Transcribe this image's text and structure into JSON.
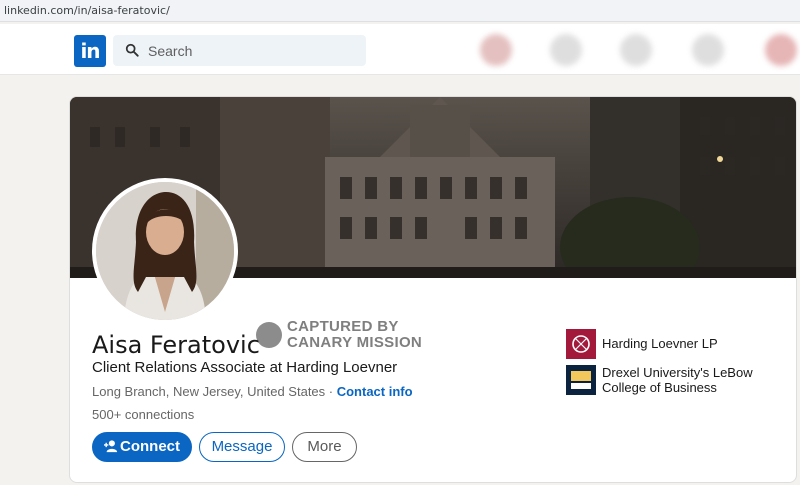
{
  "browser": {
    "url": "linkedin.com/in/aisa-feratovic/"
  },
  "nav": {
    "logo_text": "in",
    "search_placeholder": "Search",
    "icons": [
      "home-icon",
      "network-icon",
      "jobs-icon",
      "messaging-icon",
      "notifications-icon"
    ]
  },
  "profile": {
    "name": "Aisa Feratovic",
    "headline": "Client Relations Associate at Harding Loevner",
    "location": "Long Branch, New Jersey, United States",
    "location_sep": " · ",
    "contact_info": "Contact info",
    "connections": "500+ connections"
  },
  "watermark": {
    "line1": "CAPTURED BY",
    "line2": "CANARY MISSION"
  },
  "actions": {
    "connect": "Connect",
    "message": "Message",
    "more": "More"
  },
  "orgs": [
    {
      "name": "Harding Loevner LP",
      "color": "#a2193b"
    },
    {
      "name_line1": "Drexel University's LeBow",
      "name_line2": "College of Business",
      "color": "#0c2340"
    }
  ],
  "colors": {
    "brand": "#0a66c2",
    "background": "#f3f2ef"
  }
}
